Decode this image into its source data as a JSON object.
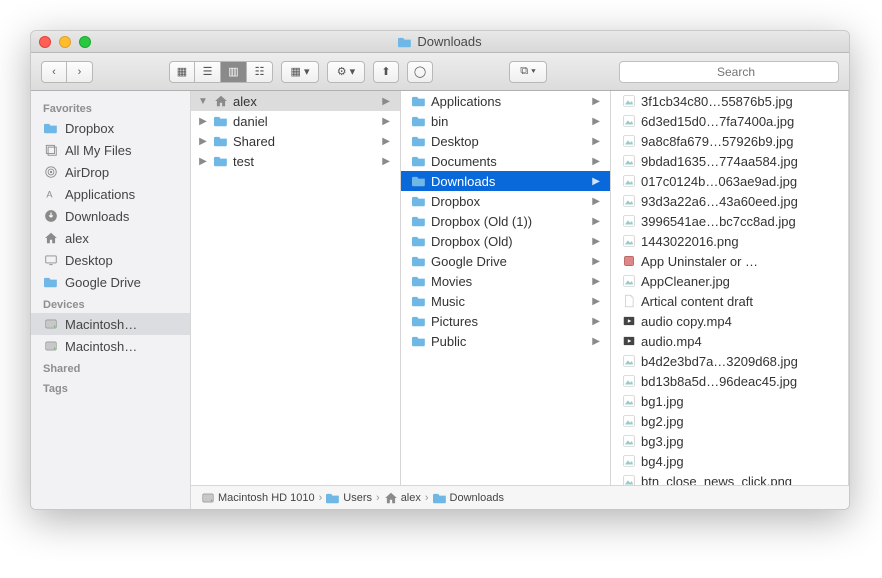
{
  "window": {
    "title": "Downloads"
  },
  "search": {
    "placeholder": "Search"
  },
  "sidebar": {
    "sections": [
      {
        "header": "Favorites",
        "items": [
          {
            "icon": "folder",
            "label": "Dropbox"
          },
          {
            "icon": "all-files",
            "label": "All My Files"
          },
          {
            "icon": "airdrop",
            "label": "AirDrop"
          },
          {
            "icon": "apps",
            "label": "Applications"
          },
          {
            "icon": "download",
            "label": "Downloads"
          },
          {
            "icon": "home",
            "label": "alex"
          },
          {
            "icon": "desktop",
            "label": "Desktop"
          },
          {
            "icon": "folder",
            "label": "Google Drive"
          }
        ]
      },
      {
        "header": "Devices",
        "items": [
          {
            "icon": "disk",
            "label": "Macintosh…",
            "selected": true
          },
          {
            "icon": "disk",
            "label": "Macintosh…"
          }
        ]
      },
      {
        "header": "Shared",
        "items": []
      },
      {
        "header": "Tags",
        "items": []
      }
    ]
  },
  "columns": {
    "col1": [
      {
        "kind": "home",
        "label": "alex",
        "expandable": true,
        "expanded": true,
        "selected": true
      },
      {
        "kind": "folder",
        "label": "daniel",
        "expandable": true
      },
      {
        "kind": "folder",
        "label": "Shared",
        "expandable": true
      },
      {
        "kind": "folder",
        "label": "test",
        "expandable": true
      }
    ],
    "col2": [
      {
        "kind": "folder",
        "label": "Applications"
      },
      {
        "kind": "folder",
        "label": "bin"
      },
      {
        "kind": "folder",
        "label": "Desktop"
      },
      {
        "kind": "folder",
        "label": "Documents"
      },
      {
        "kind": "folder",
        "label": "Downloads",
        "selected": true
      },
      {
        "kind": "folder",
        "label": "Dropbox"
      },
      {
        "kind": "folder",
        "label": "Dropbox (Old (1))"
      },
      {
        "kind": "folder",
        "label": "Dropbox (Old)"
      },
      {
        "kind": "folder",
        "label": "Google Drive"
      },
      {
        "kind": "folder",
        "label": "Movies"
      },
      {
        "kind": "folder",
        "label": "Music"
      },
      {
        "kind": "folder",
        "label": "Pictures"
      },
      {
        "kind": "folder",
        "label": "Public"
      }
    ],
    "col3": [
      {
        "kind": "image",
        "label": "3f1cb34c80…55876b5.jpg"
      },
      {
        "kind": "image",
        "label": "6d3ed15d0…7fa7400a.jpg"
      },
      {
        "kind": "image",
        "label": "9a8c8fa679…57926b9.jpg"
      },
      {
        "kind": "image",
        "label": "9bdad1635…774aa584.jpg"
      },
      {
        "kind": "image",
        "label": "017c0124b…063ae9ad.jpg"
      },
      {
        "kind": "image",
        "label": "93d3a22a6…43a60eed.jpg"
      },
      {
        "kind": "image",
        "label": "3996541ae…bc7cc8ad.jpg"
      },
      {
        "kind": "image",
        "label": "1443022016.png"
      },
      {
        "kind": "app",
        "label": "App Uninstaler or …"
      },
      {
        "kind": "image",
        "label": "AppCleaner.jpg"
      },
      {
        "kind": "doc",
        "label": "Artical content draft"
      },
      {
        "kind": "video",
        "label": "audio copy.mp4"
      },
      {
        "kind": "video",
        "label": "audio.mp4"
      },
      {
        "kind": "image",
        "label": "b4d2e3bd7a…3209d68.jpg"
      },
      {
        "kind": "image",
        "label": "bd13b8a5d…96deac45.jpg"
      },
      {
        "kind": "image",
        "label": "bg1.jpg"
      },
      {
        "kind": "image",
        "label": "bg2.jpg"
      },
      {
        "kind": "image",
        "label": "bg3.jpg"
      },
      {
        "kind": "image",
        "label": "bg4.jpg"
      },
      {
        "kind": "image",
        "label": "btn_close_news_click.png"
      }
    ]
  },
  "pathbar": [
    {
      "icon": "disk",
      "label": "Macintosh HD 1010"
    },
    {
      "icon": "folder",
      "label": "Users"
    },
    {
      "icon": "home",
      "label": "alex"
    },
    {
      "icon": "folder",
      "label": "Downloads"
    }
  ]
}
